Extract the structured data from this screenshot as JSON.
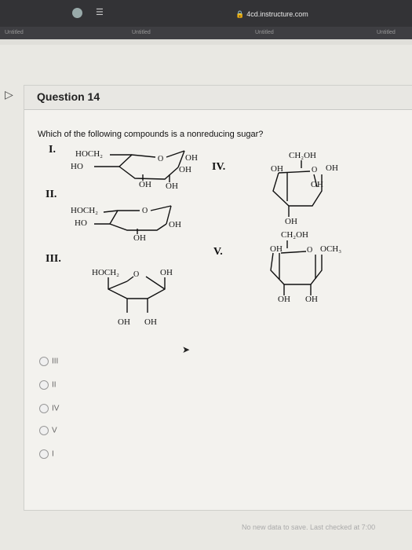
{
  "browser": {
    "url": "4cd.instructure.com",
    "tabs": [
      "Untitled",
      "Untitled",
      "Untitled",
      "Untitled"
    ]
  },
  "question": {
    "title": "Question 14",
    "prompt": "Which of the following compounds is a nonreducing sugar?"
  },
  "structures": {
    "I": {
      "numeral": "I.",
      "labels": [
        "HOCH₂",
        "HO",
        "O",
        "OH",
        "OH",
        "OH",
        "OH"
      ]
    },
    "II": {
      "numeral": "II.",
      "labels": [
        "HOCH₂",
        "HO",
        "O",
        "OH",
        "OH"
      ]
    },
    "III": {
      "numeral": "III.",
      "labels": [
        "HOCH₂",
        "O",
        "OH",
        "OH",
        "OH"
      ]
    },
    "IV": {
      "numeral": "IV.",
      "labels": [
        "CH₂OH",
        "OH",
        "O",
        "OH",
        "OH",
        "OH"
      ]
    },
    "V": {
      "numeral": "V.",
      "labels": [
        "CH₂OH",
        "OH",
        "O",
        "OCH₃",
        "OH",
        "OH"
      ]
    }
  },
  "options": [
    "III",
    "II",
    "IV",
    "V",
    "I"
  ],
  "status": "No new data to save. Last checked at 7:00"
}
